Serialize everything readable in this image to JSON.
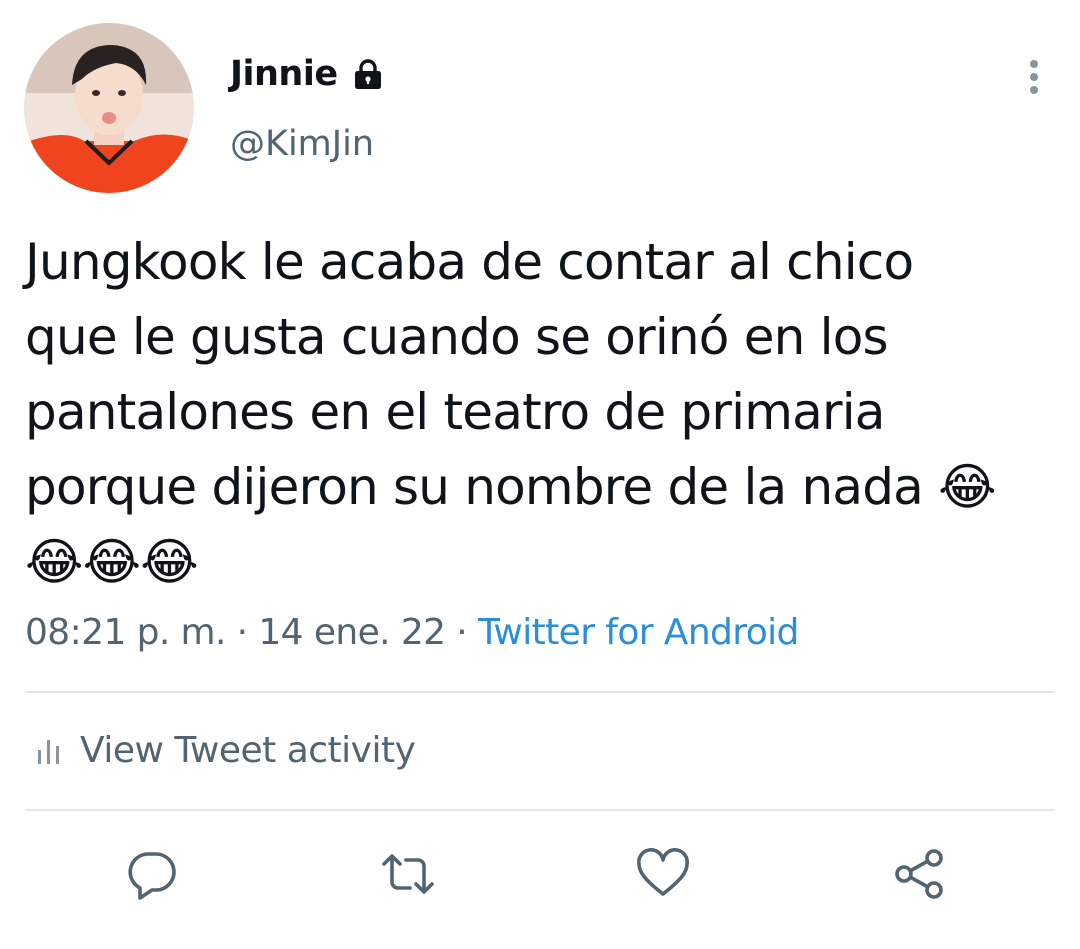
{
  "user": {
    "display_name": "Jinnie",
    "handle": "@KimJin",
    "protected_icon": "lock-icon",
    "avatar": "profile-photo"
  },
  "tweet": {
    "text": "Jungkook le acaba de contar al chico\nque le gusta cuando se orinó en los\npantalones en el teatro de primaria\nporque dijeron su nombre de la nada 😂\n😂😂😂",
    "time": "08:21 p. m.",
    "separator": " · ",
    "date": "14 ene. 22",
    "source": "Twitter for Android"
  },
  "activity": {
    "label": "View Tweet activity",
    "icon": "bar-chart-icon"
  },
  "actions": [
    {
      "name": "reply",
      "icon": "reply-icon"
    },
    {
      "name": "retweet",
      "icon": "retweet-icon"
    },
    {
      "name": "like",
      "icon": "heart-icon"
    },
    {
      "name": "share",
      "icon": "share-icon"
    }
  ],
  "colors": {
    "text": "#0f1419",
    "secondary": "#536471",
    "link": "#2a8ed8",
    "divider": "#e6e9eb",
    "icon": "#536471"
  }
}
